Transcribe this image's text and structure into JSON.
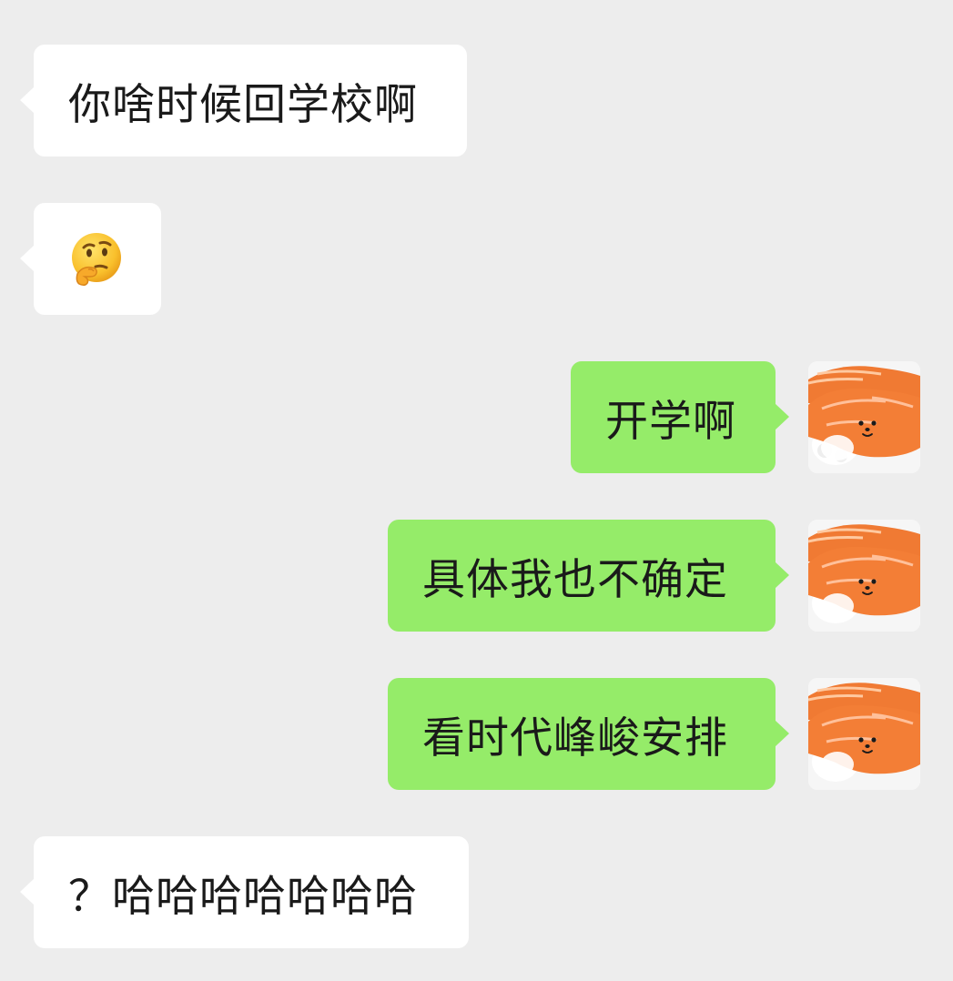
{
  "messages": [
    {
      "side": "in",
      "text": "你啥时候回学校啊"
    },
    {
      "side": "in",
      "emoji": "thinking-face"
    },
    {
      "side": "out",
      "text": "开学啊"
    },
    {
      "side": "out",
      "text": "具体我也不确定"
    },
    {
      "side": "out",
      "text": "看时代峰峻安排"
    },
    {
      "side": "in",
      "text": "？哈哈哈哈哈哈哈"
    }
  ],
  "colors": {
    "background": "#ededed",
    "incoming_bubble": "#ffffff",
    "outgoing_bubble": "#95ec69"
  },
  "avatar": {
    "icon": "salmon-sushi-bear-avatar"
  }
}
